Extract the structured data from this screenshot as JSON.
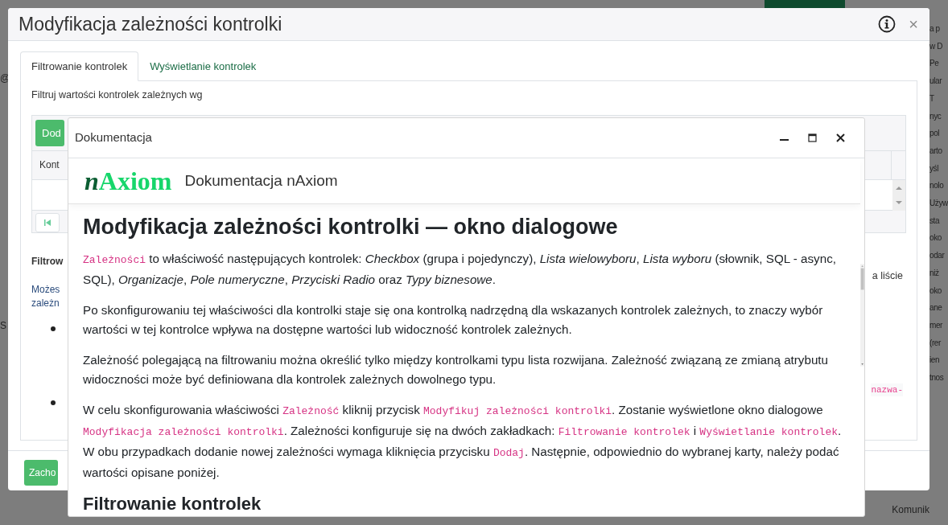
{
  "background": {
    "left_fragments": [
      "@",
      "S"
    ],
    "right_fragments": [
      "a p",
      "w D",
      "Pe",
      "ular",
      "T",
      "nyc",
      "pol",
      "arto",
      "yśl",
      "nolo",
      "Używ",
      "sta",
      "oko",
      "odar",
      "niż",
      "oko",
      "ane",
      "mer",
      "(rer",
      "ien",
      "tnos"
    ],
    "bottom_fragment": "Komunik"
  },
  "dialog": {
    "title": "Modyfikacja zależności kontrolki",
    "close_glyph": "×",
    "tabs": [
      {
        "label": "Filtrowanie kontrolek",
        "selected": true
      },
      {
        "label": "Wyświetlanie kontrolek",
        "selected": false
      }
    ],
    "filter_label": "Filtruj wartości kontrolek zależnych wg",
    "grid": {
      "add_button": "Dod",
      "column_1": "Kont"
    },
    "section_heading": "Filtrow",
    "paragraph_lines": [
      "Możes",
      "zależn"
    ],
    "right_text": "a liście",
    "right_code": "nazwa-",
    "save_button": "Zacho"
  },
  "doc_window": {
    "title": "Dokumentacja",
    "logo": {
      "prefix": "n",
      "name": "Axiom"
    },
    "heading": "Dokumentacja nAxiom",
    "content": [
      {
        "kind": "h1",
        "text": "Modyfikacja zależności kontrolki — okno dialogowe"
      },
      {
        "kind": "p",
        "parts": [
          {
            "kind": "code",
            "text": "Zależności"
          },
          {
            "kind": "text",
            "text": " to właściwość następujących kontrolek: "
          },
          {
            "kind": "em",
            "text": "Checkbox"
          },
          {
            "kind": "text",
            "text": " (grupa i pojedynczy), "
          },
          {
            "kind": "em",
            "text": "Lista wielowyboru"
          },
          {
            "kind": "text",
            "text": ", "
          },
          {
            "kind": "em",
            "text": "Lista wyboru"
          },
          {
            "kind": "text",
            "text": " (słownik, SQL - async, SQL), "
          },
          {
            "kind": "em",
            "text": "Organizacje"
          },
          {
            "kind": "text",
            "text": ", "
          },
          {
            "kind": "em",
            "text": "Pole numeryczne"
          },
          {
            "kind": "text",
            "text": ", "
          },
          {
            "kind": "em",
            "text": "Przyciski Radio"
          },
          {
            "kind": "text",
            "text": " oraz "
          },
          {
            "kind": "em",
            "text": "Typy biznesowe"
          },
          {
            "kind": "text",
            "text": "."
          }
        ]
      },
      {
        "kind": "p",
        "parts": [
          {
            "kind": "text",
            "text": "Po skonfigurowaniu tej właściwości dla kontrolki staje się ona kontrolką nadrzędną dla wskazanych kontrolek zależnych, to znaczy wybór wartości w tej kontrolce wpływa na dostępne wartości lub widoczność kontrolek zależnych."
          }
        ]
      },
      {
        "kind": "p",
        "parts": [
          {
            "kind": "text",
            "text": "Zależność polegającą na filtrowaniu można określić tylko między kontrolkami typu lista rozwijana. Zależność związaną ze zmianą atrybutu widoczności może być definiowana dla kontrolek zależnych dowolnego typu."
          }
        ]
      },
      {
        "kind": "p",
        "parts": [
          {
            "kind": "text",
            "text": "W celu skonfigurowania właściwości "
          },
          {
            "kind": "code",
            "text": "Zależność"
          },
          {
            "kind": "text",
            "text": " kliknij przycisk "
          },
          {
            "kind": "code",
            "text": "Modyfikuj zależności kontrolki"
          },
          {
            "kind": "text",
            "text": ". Zostanie wyświetlone okno dialogowe "
          },
          {
            "kind": "code",
            "text": "Modyfikacja zależności kontrolki"
          },
          {
            "kind": "text",
            "text": ". Zależności konfiguruje się na dwóch zakładkach: "
          },
          {
            "kind": "code",
            "text": "Filtrowanie kontrolek"
          },
          {
            "kind": "text",
            "text": " i "
          },
          {
            "kind": "code",
            "text": "Wyświetlanie kontrolek"
          },
          {
            "kind": "text",
            "text": ". W obu przypadkach dodanie nowej zależności wymaga kliknięcia przycisku "
          },
          {
            "kind": "code",
            "text": "Dodaj"
          },
          {
            "kind": "text",
            "text": ". Następnie, odpowiednio do wybranej karty, należy podać wartości opisane poniżej."
          }
        ]
      },
      {
        "kind": "h2",
        "text": "Filtrowanie kontrolek"
      }
    ]
  }
}
